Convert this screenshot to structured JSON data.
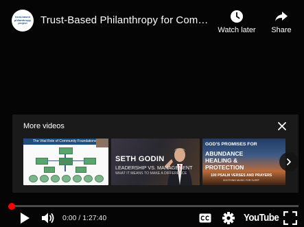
{
  "header": {
    "title": "Trust-Based Philanthropy for Comm...",
    "avatar_text": "trust-based philanthropy project",
    "watch_later_label": "Watch later",
    "share_label": "Share"
  },
  "more_videos": {
    "title": "More videos",
    "videos": [
      {
        "heading": "The Vital Role of Community Foundations"
      },
      {
        "name": "SETH GODIN",
        "line1": "LEADERSHIP VS. MANAGEMENT",
        "line2": "WHAT IT MEANS TO MAKE A DIFFERENCE"
      },
      {
        "line1": "GOD'S PROMISES FOR",
        "line2": "ABUNDANCE",
        "line3": "HEALING &",
        "line4": "PROTECTION",
        "line5": "100 PSALM VERSES AND PRAYERS",
        "line6": "SOOTHING MUSIC FOR SLEEP"
      }
    ]
  },
  "controls": {
    "time": "0:00 / 1:27:40",
    "progress_fraction": 0,
    "logo_text": "YouTube"
  },
  "colors": {
    "accent": "#ff0000",
    "background": "#000000",
    "panel": "#1c1c1c"
  }
}
